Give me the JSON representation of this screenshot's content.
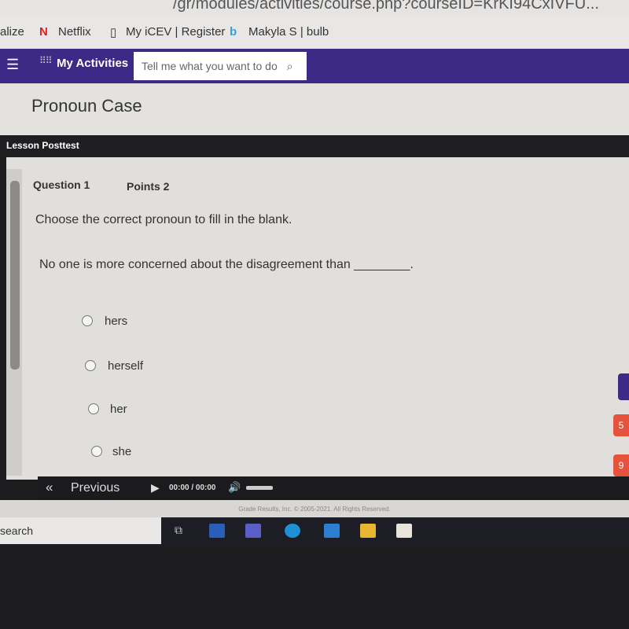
{
  "browser": {
    "url": "/gr/modules/activities/course.php?courseID=KrKI94CxIVFU...",
    "bookmarks": [
      "alize",
      "Netflix",
      "My iCEV | Register",
      "Makyla S | bulb"
    ]
  },
  "nav": {
    "app": "My Activities",
    "search_placeholder": "Tell me what you want to do"
  },
  "page": {
    "title": "Pronoun Case",
    "section": "Lesson Posttest"
  },
  "question": {
    "number": "Question 1",
    "points": "Points 2",
    "instruction": "Choose the correct pronoun to fill in the blank.",
    "sentence": "No one is more concerned about the disagreement than ________.",
    "options": [
      "hers",
      "herself",
      "her",
      "she"
    ]
  },
  "player": {
    "previous": "Previous",
    "time": "00:00 / 00:00"
  },
  "footer": {
    "copyright": "Grade Results, Inc. © 2005-2021. All Rights Reserved."
  },
  "side_badges": [
    "5",
    "9"
  ],
  "taskbar": {
    "search": "search"
  },
  "colors": {
    "nav": "#3d2a86",
    "badge": "#e5533d"
  }
}
